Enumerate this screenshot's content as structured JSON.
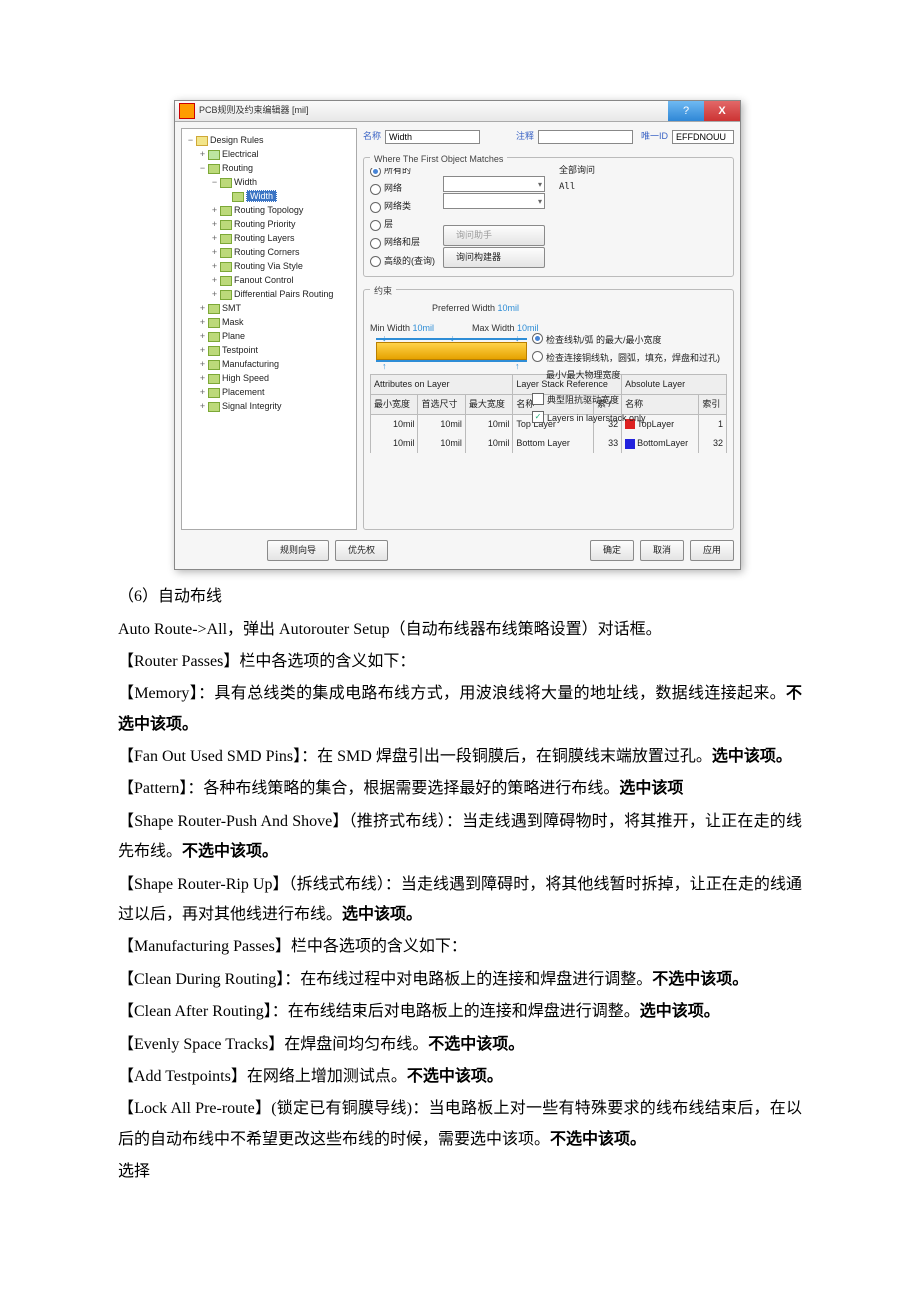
{
  "dialog": {
    "title": "PCB规则及约束编辑器 [mil]",
    "help": "?",
    "close": "X",
    "tree": {
      "root": "Design Rules",
      "electrical": "Electrical",
      "routing": "Routing",
      "width_parent": "Width",
      "width_sel": "Width",
      "items": [
        "Routing Topology",
        "Routing Priority",
        "Routing Layers",
        "Routing Corners",
        "Routing Via Style",
        "Fanout Control",
        "Differential Pairs Routing"
      ],
      "rest": [
        "SMT",
        "Mask",
        "Plane",
        "Testpoint",
        "Manufacturing",
        "High Speed",
        "Placement",
        "Signal Integrity"
      ]
    },
    "fields": {
      "name_label": "名称",
      "name_value": "Width",
      "comment_label": "注释",
      "comment_value": "",
      "id_label": "唯一ID",
      "id_value": "EFFDNOUU"
    },
    "match_group": "Where The First Object Matches",
    "radios": [
      "所有的",
      "网络",
      "网络类",
      "层",
      "网络和层",
      "高级的(查询)"
    ],
    "query_label": "全部询问",
    "query_value": "All",
    "btn_helper": "询问助手",
    "btn_builder": "询问构建器",
    "constraint_label": "约束",
    "pref_label": "Preferred Width",
    "pref_val": "10mil",
    "min_label": "Min Width",
    "min_val": "10mil",
    "max_label": "Max Width",
    "max_val": "10mil",
    "opts": {
      "r1": "检查线轨/弧 的最大/最小宽度",
      "r2": "检查连接铜线轨，圆弧，填充，焊盘和过孔)最小/最大物理宽度",
      "c1": "典型阻抗驱动宽度",
      "c2": "Layers in layerstack only"
    },
    "headers": {
      "h1": "Attributes on Layer",
      "h2": "Layer Stack Reference",
      "h3": "Absolute Layer"
    },
    "cols": {
      "c1": "最小宽度",
      "c2": "首选尺寸",
      "c3": "最大宽度",
      "c4": "名称",
      "c5": "索 /",
      "c6": "名称",
      "c7": "索引"
    },
    "rows": [
      {
        "min": "10mil",
        "pref": "10mil",
        "max": "10mil",
        "layer": "Top Layer",
        "idx": "32",
        "abs": "TopLayer",
        "aidx": "1"
      },
      {
        "min": "10mil",
        "pref": "10mil",
        "max": "10mil",
        "layer": "Bottom Layer",
        "idx": "33",
        "abs": "BottomLayer",
        "aidx": "32"
      }
    ],
    "footer": {
      "wiz": "规则向导",
      "pri": "优先权",
      "ok": "确定",
      "cancel": "取消",
      "apply": "应用"
    }
  },
  "doc": {
    "p0": "（6）自动布线",
    "p1": "Auto Route->All，弹出 Autorouter Setup（自动布线器布线策略设置）对话框。",
    "p2": "【Router Passes】栏中各选项的含义如下：",
    "p3a": "【Memory】：具有总线类的集成电路布线方式，用波浪线将大量的地址线，数据线连接起来。",
    "p3b": "不选中该项。",
    "p4a": "【Fan Out Used SMD Pins】：在 SMD 焊盘引出一段铜膜后，在铜膜线末端放置过孔。",
    "p4b": "选中该项。",
    "p5a": "【Pattern】：各种布线策略的集合，根据需要选择最好的策略进行布线。",
    "p5b": "选中该项",
    "p6a": "【Shape Router-Push And Shove】（推挤式布线）：当走线遇到障碍物时，将其推开，让正在走的线先布线。",
    "p6b": "不选中该项。",
    "p7a": "【Shape Router-Rip Up】（拆线式布线）：当走线遇到障碍时，将其他线暂时拆掉，让正在走的线通过以后，再对其他线进行布线。",
    "p7b": "选中该项。",
    "p8": "【Manufacturing Passes】栏中各选项的含义如下：",
    "p9a": "【Clean During Routing】：在布线过程中对电路板上的连接和焊盘进行调整。",
    "p9b": "不选中该项。",
    "p10a": "【Clean After Routing】：在布线结束后对电路板上的连接和焊盘进行调整。",
    "p10b": "选中该项。",
    "p11a": "【Evenly Space Tracks】在焊盘间均匀布线。",
    "p11b": "不选中该项。",
    "p12a": "【Add Testpoints】在网络上增加测试点。",
    "p12b": "不选中该项。",
    "p13a": "【Lock All Pre-route】(锁定已有铜膜导线)：当电路板上对一些有特殊要求的线布线结束后，在以后的自动布线中不希望更改这些布线的时候，需要选中该项。",
    "p13b": "不选中该项。",
    "p14": "选择"
  }
}
